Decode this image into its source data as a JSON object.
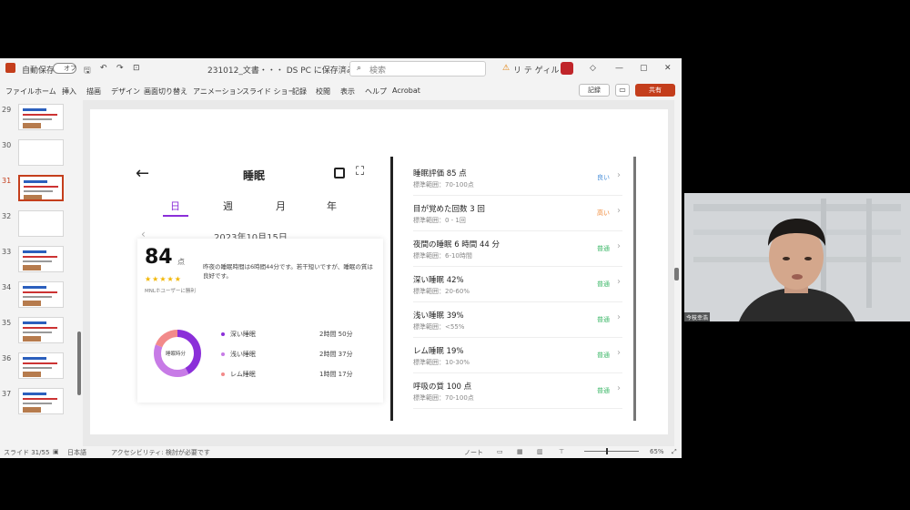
{
  "titlebar": {
    "autosave": "自動保存",
    "toggle": "オフ",
    "filename": "231012_文書・・・ DS PC に保存済み ∨",
    "search": "検索",
    "warning": "リ テ ゲィル",
    "min": "—",
    "max": "▢",
    "close": "✕"
  },
  "menu": {
    "tabs": [
      "ファイル",
      "ホーム",
      "挿入",
      "描画",
      "デザイン",
      "画面切り替え",
      "アニメーション",
      "スライド ショー",
      "記録",
      "校閲",
      "表示",
      "ヘルプ",
      "Acrobat"
    ],
    "record": "記録",
    "share": "共有"
  },
  "thumbnails": [
    {
      "num": "29"
    },
    {
      "num": "30"
    },
    {
      "num": "31"
    },
    {
      "num": "32"
    },
    {
      "num": "33"
    },
    {
      "num": "34"
    },
    {
      "num": "35"
    },
    {
      "num": "36"
    },
    {
      "num": "37"
    }
  ],
  "slide": {
    "left": {
      "title": "睡眠",
      "tabs": [
        "日",
        "週",
        "月",
        "年"
      ],
      "date": "2023年10月15日",
      "score": "84",
      "score_unit": "点",
      "score_note": "MNLホユーザーに勝利",
      "summary": "昨夜の睡眠時間は6時間44分です。若干短いですが、睡眠の質は良好です。",
      "donut_label": "睡眠時分",
      "legend": [
        {
          "label": "深い睡眠",
          "value": "2時間 50分",
          "color": "#8b2fd9"
        },
        {
          "label": "浅い睡眠",
          "value": "2時間 37分",
          "color": "#c77be6"
        },
        {
          "label": "レム睡眠",
          "value": "1時間 17分",
          "color": "#f28a8a"
        }
      ]
    },
    "right": {
      "metrics": [
        {
          "title": "睡眠評価 85 点",
          "sub": "標準範囲：70-100点",
          "badge": "良い",
          "color": "#4a8fd9"
        },
        {
          "title": "目が覚めた回数 3 回",
          "sub": "標準範囲：0 - 1回",
          "badge": "高い",
          "color": "#f08a3a"
        },
        {
          "title": "夜間の睡眠 6 時間 44 分",
          "sub": "標準範囲：6-10時間",
          "badge": "普通",
          "color": "#3fb86a"
        },
        {
          "title": "深い睡眠 42%",
          "sub": "標準範囲：20-60%",
          "badge": "普通",
          "color": "#3fb86a"
        },
        {
          "title": "浅い睡眠 39%",
          "sub": "標準範囲：<55%",
          "badge": "普通",
          "color": "#3fb86a"
        },
        {
          "title": "レム睡眠 19%",
          "sub": "標準範囲：10-30%",
          "badge": "普通",
          "color": "#3fb86a"
        },
        {
          "title": "呼吸の質 100 点",
          "sub": "標準範囲：70-100点",
          "badge": "普通",
          "color": "#3fb86a"
        }
      ]
    }
  },
  "status": {
    "slide": "スライド 31/55",
    "lang": "日本語",
    "access": "アクセシビリティ: 検討が必要です",
    "notes": "ノート",
    "zoom": "65%"
  },
  "webcam": {
    "name": "今枝幸浩"
  },
  "colors": {
    "accent": "#c43e1c",
    "brand": "#8b2fd9"
  }
}
